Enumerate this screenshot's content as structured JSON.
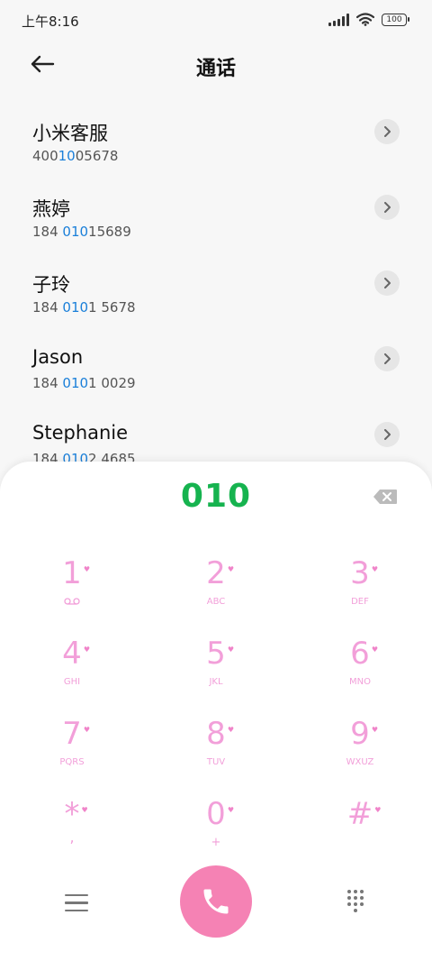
{
  "status": {
    "time": "上午8:16",
    "battery": "100"
  },
  "header": {
    "title": "通话"
  },
  "contacts": [
    {
      "name": "小米客服",
      "num_pre": "400",
      "num_hl": "10",
      "num_post": "05678"
    },
    {
      "name": "燕婷",
      "num_pre": "184 ",
      "num_hl": "010",
      "num_post": "15689"
    },
    {
      "name": "子玲",
      "num_pre": "184 ",
      "num_hl": "010",
      "num_post": "1 5678"
    },
    {
      "name": "Jason",
      "num_pre": "184 ",
      "num_hl": "010",
      "num_post": "1 0029"
    },
    {
      "name": "Stephanie",
      "num_pre": "184 ",
      "num_hl": "010",
      "num_post": "2 4685"
    }
  ],
  "dialer": {
    "input": "010",
    "keys": [
      {
        "digit": "1",
        "letters": "QO"
      },
      {
        "digit": "2",
        "letters": "ABC"
      },
      {
        "digit": "3",
        "letters": "DEF"
      },
      {
        "digit": "4",
        "letters": "GHI"
      },
      {
        "digit": "5",
        "letters": "JKL"
      },
      {
        "digit": "6",
        "letters": "MNO"
      },
      {
        "digit": "7",
        "letters": "PQRS"
      },
      {
        "digit": "8",
        "letters": "TUV"
      },
      {
        "digit": "9",
        "letters": "WXUZ"
      },
      {
        "digit": "*",
        "letters": ","
      },
      {
        "digit": "0",
        "letters": "+"
      },
      {
        "digit": "#",
        "letters": ""
      }
    ]
  },
  "colors": {
    "accent_green": "#16b34f",
    "call_pink": "#f582b4",
    "key_pink": "#f29fd9",
    "link_blue": "#1a7fd9"
  },
  "icons": [
    "back-arrow-icon",
    "chevron-right-icon",
    "backspace-icon",
    "menu-icon",
    "phone-icon",
    "dialpad-icon"
  ]
}
